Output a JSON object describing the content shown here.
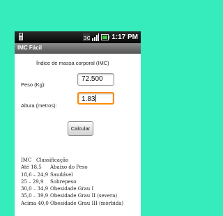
{
  "status_bar": {
    "time": "1:17 PM"
  },
  "app": {
    "title": "IMC Fácil"
  },
  "form": {
    "heading": "Índice de massa corporal (IMC)",
    "peso_label": "Peso (Kg):",
    "peso_value": "72.500",
    "altura_label": "Altura (metros):",
    "altura_value": "1.83",
    "calcular_label": "Calcular"
  },
  "classification": {
    "header": [
      "IMC",
      "Classificação"
    ],
    "rows": [
      [
        "Até 18,5",
        "Abaixo do Peso"
      ],
      [
        "18,6 – 24,9",
        "Saudável"
      ],
      [
        "25 – 29,9",
        "Sobrepeso"
      ],
      [
        "30,0 – 34,9",
        "Obesidade Grau I"
      ],
      [
        "35,0 – 39,9",
        "Obesidade Grau II (severa)"
      ],
      [
        "Acima 40,0",
        "Obesidade Grau III (mórbida)"
      ]
    ]
  },
  "colors": {
    "background": "#36ecbc",
    "focus": "#ff8a00",
    "battery": "#3ec33e"
  }
}
